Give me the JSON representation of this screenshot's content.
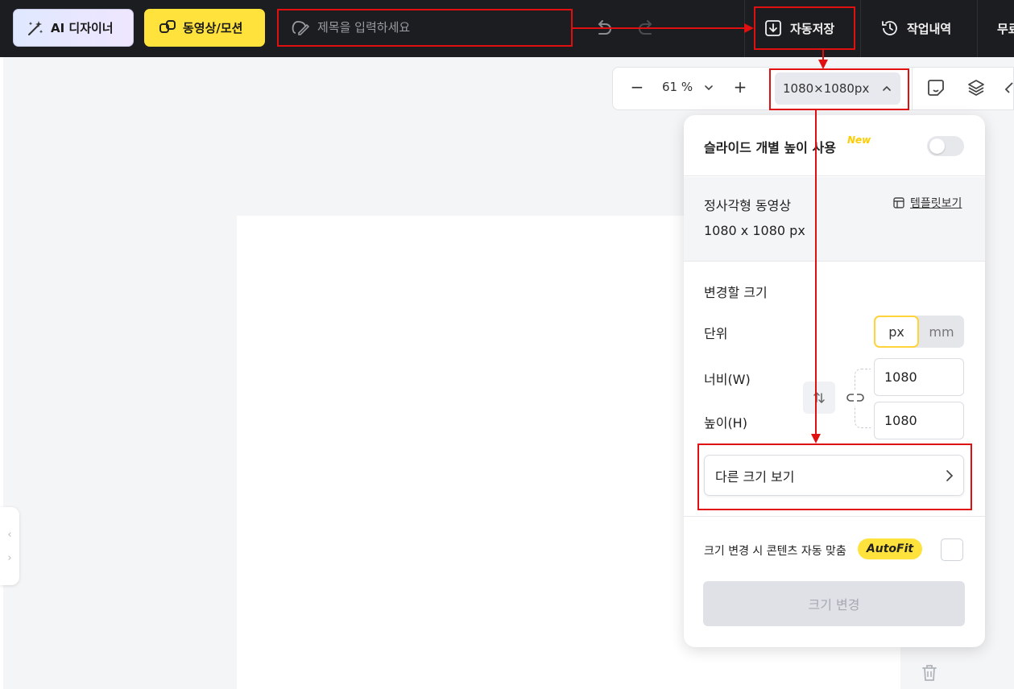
{
  "toolbar": {
    "ai_designer_label": "AI 디자이너",
    "video_motion_label": "동영상/모션",
    "title_placeholder": "제목을 입력하세요",
    "autosave_label": "자동저장",
    "history_label": "작업내역",
    "free_label": "무료"
  },
  "zoom": {
    "value": "61 %",
    "canvas_size": "1080×1080px"
  },
  "panel": {
    "slide_height_label": "슬라이드 개별 높이 사용",
    "new_badge": "New",
    "current_format": "정사각형 동영상",
    "current_size": "1080 x 1080 px",
    "template_link": "템플릿보기",
    "resize_title": "변경할 크기",
    "unit_label": "단위",
    "unit_px": "px",
    "unit_mm": "mm",
    "width_label": "너비(W)",
    "height_label": "높이(H)",
    "width_value": "1080",
    "height_value": "1080",
    "other_sizes": "다른 크기 보기",
    "autofit_label": "크기 변경 시 콘텐츠 자동 맞춤",
    "autofit_badge": "AutoFit",
    "apply_button": "크기 변경"
  },
  "colors": {
    "topbar": "#1c1d20",
    "brand_yellow": "#ffe23c",
    "annotation_red": "#e01010"
  },
  "icons": [
    "magic-wand-icon",
    "video-link-icon",
    "edit-icon",
    "undo-icon",
    "redo-icon",
    "save-icon",
    "history-icon",
    "chevron-down-icon",
    "chevron-up-icon",
    "sticker-icon",
    "layers-icon",
    "eraser-icon",
    "template-icon",
    "swap-icon",
    "link-icon",
    "chevron-right-icon",
    "trash-icon"
  ]
}
